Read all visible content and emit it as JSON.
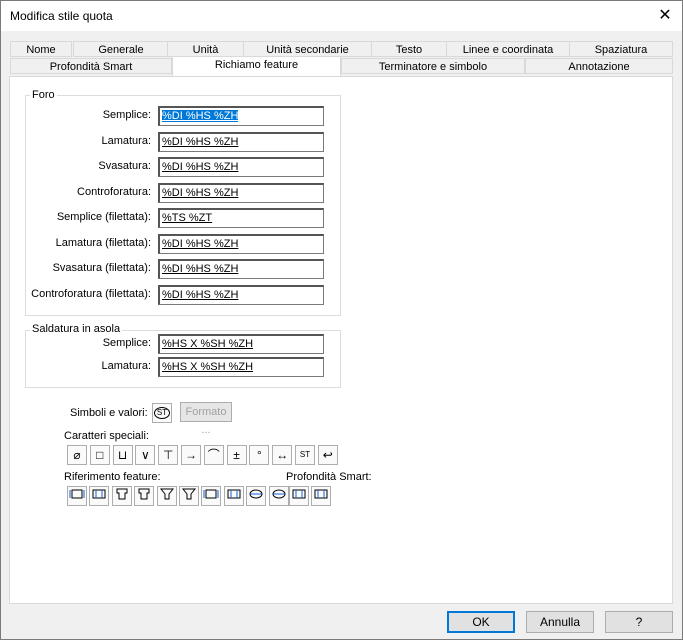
{
  "window": {
    "title": "Modifica stile quota",
    "close_symbol": "✕"
  },
  "tabs_row1": [
    {
      "label": "Nome"
    },
    {
      "label": "Generale"
    },
    {
      "label": "Unità"
    },
    {
      "label": "Unità secondarie"
    },
    {
      "label": "Testo"
    },
    {
      "label": "Linee e coordinata"
    },
    {
      "label": "Spaziatura"
    }
  ],
  "tabs_row2": [
    {
      "label": "Profondità Smart"
    },
    {
      "label": "Richiamo feature"
    },
    {
      "label": "Terminatore e simbolo"
    },
    {
      "label": "Annotazione"
    }
  ],
  "foro": {
    "title": "Foro",
    "rows": [
      {
        "label": "Semplice:",
        "value": "%DI %HS %ZH",
        "selected": true
      },
      {
        "label": "Lamatura:",
        "value": "%DI %HS %ZH"
      },
      {
        "label": "Svasatura:",
        "value": "%DI %HS %ZH"
      },
      {
        "label": "Controforatura:",
        "value": "%DI %HS %ZH"
      },
      {
        "label": "Semplice (filettata):",
        "value": "%TS %ZT"
      },
      {
        "label": "Lamatura (filettata):",
        "value": "%DI %HS %ZH"
      },
      {
        "label": "Svasatura (filettata):",
        "value": "%DI %HS %ZH"
      },
      {
        "label": "Controforatura (filettata):",
        "value": "%DI %HS %ZH"
      }
    ]
  },
  "asola": {
    "title": "Saldatura in asola",
    "rows": [
      {
        "label": "Semplice:",
        "value": "%HS X %SH %ZH"
      },
      {
        "label": "Lamatura:",
        "value": "%HS X %SH %ZH"
      }
    ]
  },
  "simboli": {
    "label": "Simboli e valori:",
    "icon_text": "ST",
    "format_button": "Formato ..."
  },
  "caratteri": {
    "label": "Caratteri speciali:",
    "symbols": [
      "⌀",
      "□",
      "⊔",
      "∨",
      "⊤",
      "→",
      "⌒",
      "±",
      "°",
      "↔",
      "ST",
      "↩"
    ]
  },
  "riferimento": {
    "label": "Riferimento feature:"
  },
  "profondita": {
    "label": "Profondità Smart:"
  },
  "footer": {
    "ok": "OK",
    "cancel": "Annulla",
    "help": "?"
  }
}
